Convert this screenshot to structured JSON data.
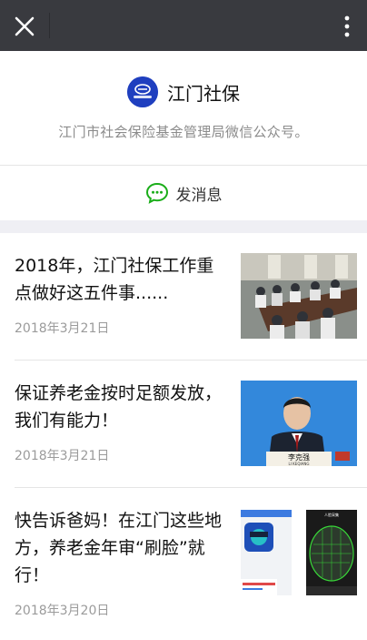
{
  "topbar": {
    "close_icon": "close-icon",
    "more_icon": "more-vertical-icon",
    "bg_color": "#393a3f"
  },
  "account": {
    "name": "江门社保",
    "description": "江门市社会保险基金管理局微信公众号。",
    "logo_icon": "social-security-logo",
    "logo_color": "#1f3fbf"
  },
  "actions": {
    "send_message_label": "发消息",
    "send_message_icon": "chat-bubble-icon",
    "accent_color": "#1aad19"
  },
  "articles": [
    {
      "title": "2018年，江门社保工作重点做好这五件事......",
      "date": "2018年3月21日",
      "thumbnail": "meeting-photo"
    },
    {
      "title": "保证养老金按时足额发放，我们有能力！",
      "date": "2018年3月21日",
      "thumbnail": "press-conference-photo",
      "thumb_caption": "李克强",
      "thumb_caption_en": "LI KEQIANG"
    },
    {
      "title": "快告诉爸妈！在江门这些地方，养老金年审“刷脸”就行！",
      "date": "2018年3月20日",
      "thumbnail": "face-recognition-screens",
      "thumb_caption": "人脸采集"
    }
  ]
}
